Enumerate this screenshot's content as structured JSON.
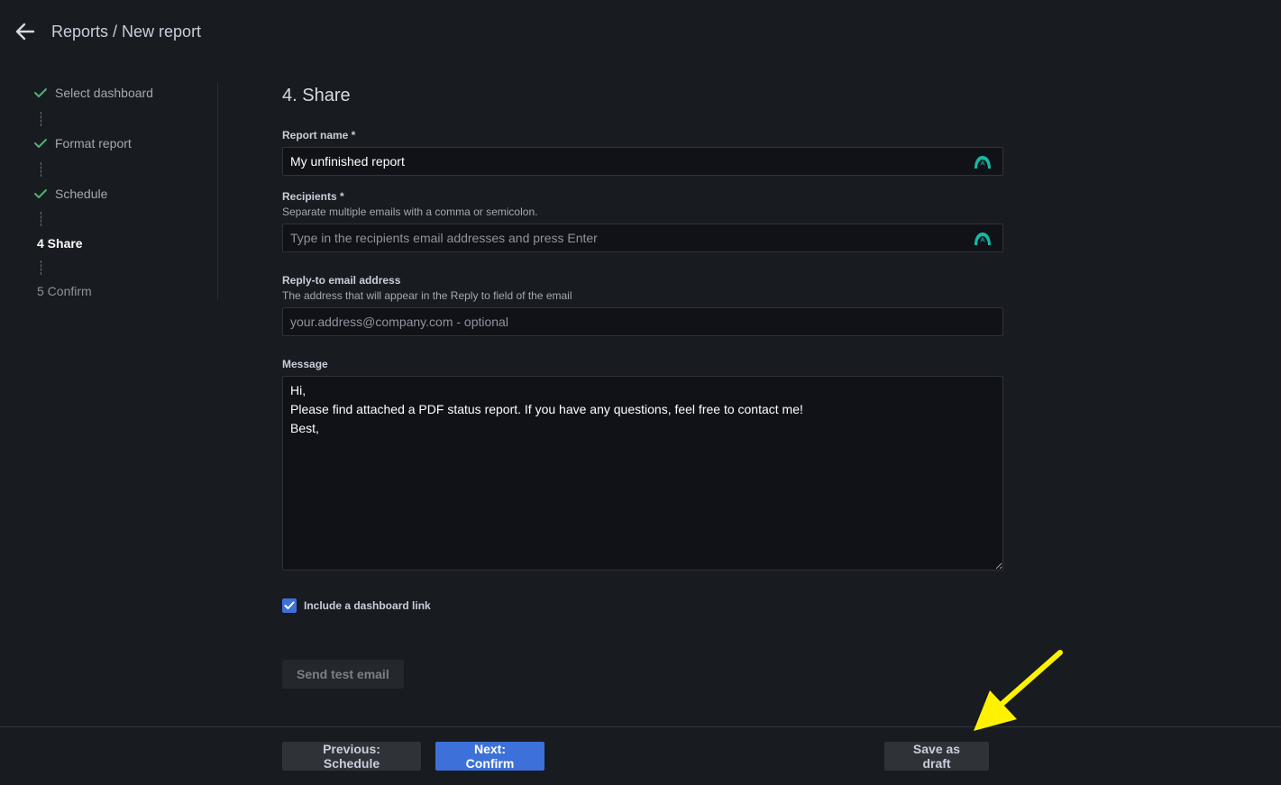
{
  "header": {
    "title": "Reports / New report"
  },
  "stepper": {
    "steps": [
      {
        "label": "Select dashboard",
        "state": "done"
      },
      {
        "label": "Format report",
        "state": "done"
      },
      {
        "label": "Schedule",
        "state": "done"
      },
      {
        "label": "4 Share",
        "state": "active"
      },
      {
        "label": "5 Confirm",
        "state": "pending"
      }
    ]
  },
  "form": {
    "section_title": "4. Share",
    "report_name": {
      "label": "Report name *",
      "value": "My unfinished report"
    },
    "recipients": {
      "label": "Recipients *",
      "description": "Separate multiple emails with a comma or semicolon.",
      "placeholder": "Type in the recipients email addresses and press Enter"
    },
    "reply_to": {
      "label": "Reply-to email address",
      "description": "The address that will appear in the Reply to field of the email",
      "placeholder": "your.address@company.com - optional"
    },
    "message": {
      "label": "Message",
      "value": "Hi,\nPlease find attached a PDF status report. If you have any questions, feel free to contact me!\nBest,"
    },
    "include_link": {
      "label": "Include a dashboard link",
      "checked": true
    },
    "send_test_label": "Send test email"
  },
  "footer": {
    "previous_label": "Previous: Schedule",
    "next_label": "Next: Confirm",
    "draft_label": "Save as draft"
  },
  "colors": {
    "accent": "#3d71d9",
    "check": "#4bb374",
    "annotation": "#fff200",
    "grammar_icon": "#15b8a6"
  }
}
